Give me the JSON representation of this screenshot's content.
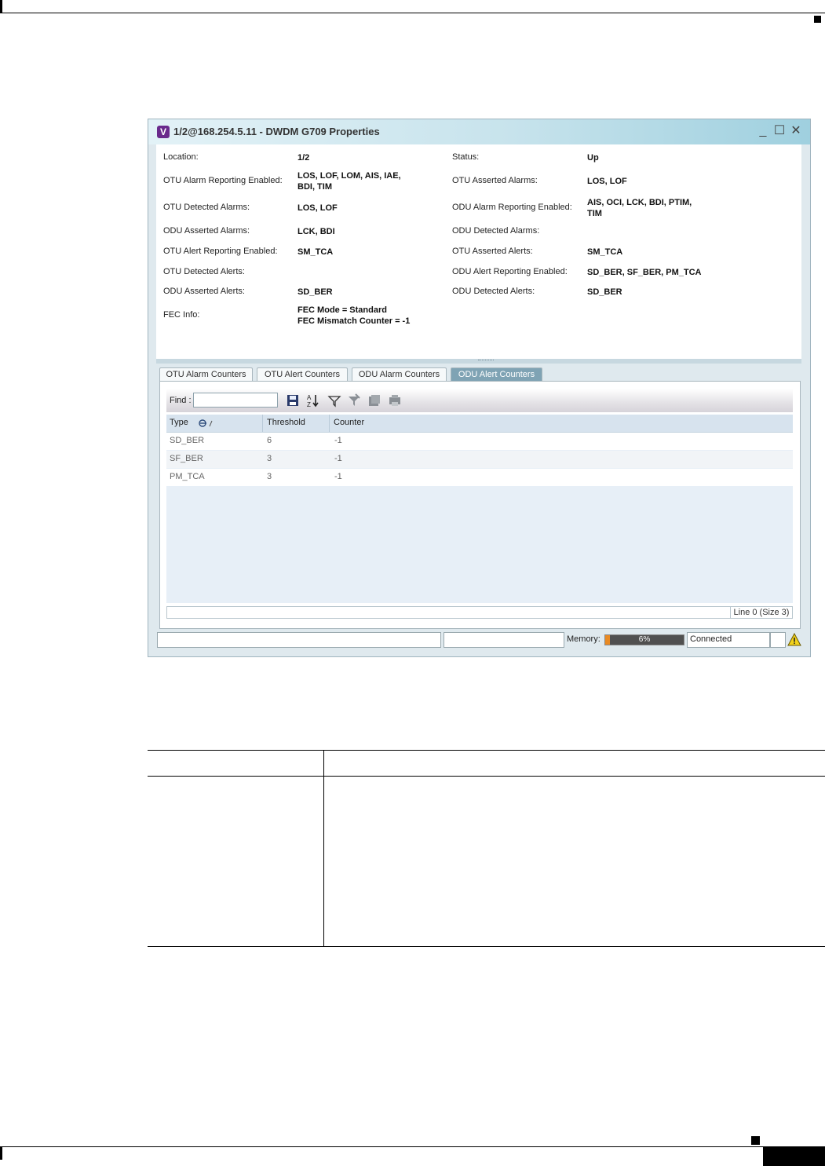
{
  "page": {
    "figure_id": "237520"
  },
  "window": {
    "title": "1/2@168.254.5.11 - DWDM G709 Properties",
    "logo_letter": "V",
    "buttons": {
      "minimize": "_",
      "maximize": "☐",
      "close": "✕"
    }
  },
  "properties": {
    "left": [
      {
        "label": "Location:",
        "value": "1/2"
      },
      {
        "label": "OTU Alarm Reporting Enabled:",
        "value_line1": "LOS, LOF, LOM, AIS, IAE,",
        "value_line2": "BDI, TIM"
      },
      {
        "label": "OTU Detected Alarms:",
        "value": "LOS, LOF"
      },
      {
        "label": "ODU Asserted Alarms:",
        "value": "LCK, BDI"
      },
      {
        "label": "OTU Alert Reporting Enabled:",
        "value": "SM_TCA"
      },
      {
        "label": "OTU Detected Alerts:",
        "value": ""
      },
      {
        "label": "ODU Asserted Alerts:",
        "value": "SD_BER"
      },
      {
        "label": "FEC Info:",
        "value_line1": "FEC Mode = Standard",
        "value_line2": "FEC Mismatch Counter = -1"
      }
    ],
    "right": [
      {
        "label": "Status:",
        "value": "Up"
      },
      {
        "label": "OTU Asserted Alarms:",
        "value": "LOS, LOF"
      },
      {
        "label": "ODU Alarm Reporting Enabled:",
        "value_line1": "AIS, OCI, LCK, BDI, PTIM,",
        "value_line2": "TIM"
      },
      {
        "label": "ODU Detected Alarms:",
        "value": ""
      },
      {
        "label": "OTU Asserted Alerts:",
        "value": "SM_TCA"
      },
      {
        "label": "ODU Alert Reporting Enabled:",
        "value": "SD_BER, SF_BER, PM_TCA"
      },
      {
        "label": "ODU Detected Alerts:",
        "value": "SD_BER"
      }
    ]
  },
  "tabs": [
    {
      "label": "OTU Alarm Counters",
      "active": false
    },
    {
      "label": "OTU Alert Counters",
      "active": false
    },
    {
      "label": "ODU Alarm Counters",
      "active": false
    },
    {
      "label": "ODU Alert Counters",
      "active": true
    }
  ],
  "toolbar": {
    "find_label": "Find :",
    "find_value": "",
    "icons": [
      "save-icon",
      "sort-az-icon",
      "filter-icon",
      "filter-clear-icon",
      "export-icon",
      "print-icon"
    ]
  },
  "grid": {
    "columns": [
      "Type",
      "Threshold",
      "Counter"
    ],
    "rows": [
      {
        "type": "SD_BER",
        "threshold": "6",
        "counter": "-1"
      },
      {
        "type": "SF_BER",
        "threshold": "3",
        "counter": "-1"
      },
      {
        "type": "PM_TCA",
        "threshold": "3",
        "counter": "-1"
      }
    ],
    "line_info": "Line 0 (Size 3)"
  },
  "statusbar": {
    "memory_label": "Memory:",
    "memory_percent": 6,
    "memory_text": "6%",
    "connection": "Connected"
  },
  "colors": {
    "accent": "#7fa3b4",
    "memory_fill": "#e98a23",
    "warning": "#f2d21b"
  }
}
